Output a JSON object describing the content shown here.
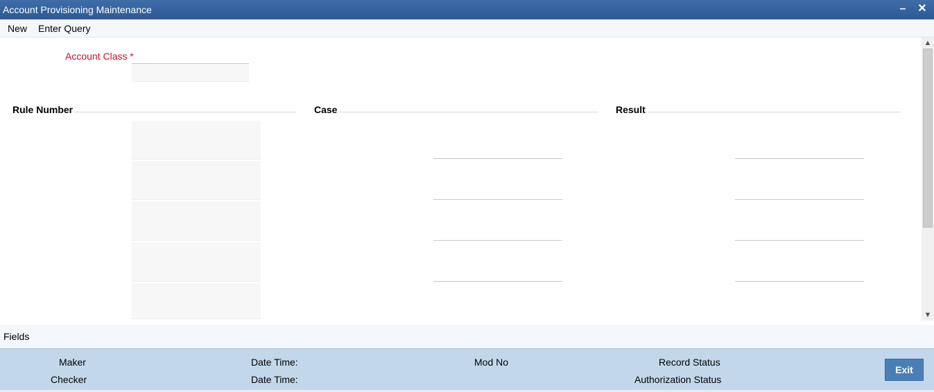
{
  "window": {
    "title": "Account Provisioning Maintenance",
    "minimize_glyph": "–",
    "close_glyph": "✕"
  },
  "menu": {
    "items": [
      "New",
      "Enter Query"
    ]
  },
  "form": {
    "account_class_label": "Account Class",
    "required_mark": "*",
    "account_class_value": ""
  },
  "sections": {
    "rule_number": "Rule Number",
    "case": "Case",
    "result": "Result"
  },
  "rows": [
    {
      "rule_number": "",
      "case": "",
      "result": ""
    },
    {
      "rule_number": "",
      "case": "",
      "result": ""
    },
    {
      "rule_number": "",
      "case": "",
      "result": ""
    },
    {
      "rule_number": "",
      "case": "",
      "result": ""
    },
    {
      "rule_number": ""
    }
  ],
  "fields_bar": {
    "label": "Fields"
  },
  "footer": {
    "maker": "Maker",
    "checker": "Checker",
    "date_time_1": "Date Time:",
    "date_time_2": "Date Time:",
    "mod_no": "Mod No",
    "record_status": "Record Status",
    "authorization_status": "Authorization Status",
    "exit_label": "Exit"
  },
  "scrollbar": {
    "up_icon": "scroll-up-icon",
    "down_icon": "scroll-down-icon"
  },
  "colors": {
    "title_bar": "#2d5994",
    "required_label": "#c8102e",
    "footer_bg": "#c2d8ea",
    "exit_button": "#4a7fb5"
  }
}
